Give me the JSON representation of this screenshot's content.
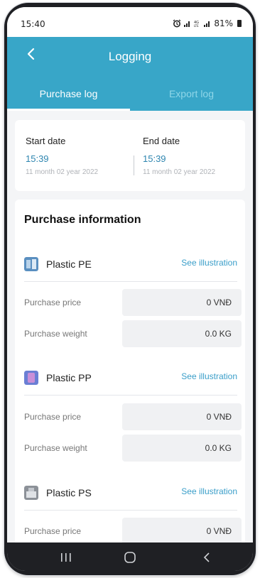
{
  "status": {
    "time": "15:40",
    "battery": "81%"
  },
  "header": {
    "title": "Logging"
  },
  "tabs": [
    {
      "label": "Purchase log",
      "active": true
    },
    {
      "label": "Export log",
      "active": false
    }
  ],
  "dates": {
    "start": {
      "label": "Start date",
      "time": "15:39",
      "date": "11 month 02 year 2022"
    },
    "end": {
      "label": "End date",
      "time": "15:39",
      "date": "11 month 02 year 2022"
    }
  },
  "purchase": {
    "title": "Purchase information",
    "see_label": "See illustration",
    "items": [
      {
        "name": "Plastic PE",
        "icon": "plastic-pe-icon",
        "price_label": "Purchase price",
        "price": "0  VNĐ",
        "weight_label": "Purchase weight",
        "weight": "0.0  KG"
      },
      {
        "name": "Plastic PP",
        "icon": "plastic-pp-icon",
        "price_label": "Purchase price",
        "price": "0  VNĐ",
        "weight_label": "Purchase weight",
        "weight": "0.0  KG"
      },
      {
        "name": "Plastic PS",
        "icon": "plastic-ps-icon",
        "price_label": "Purchase price",
        "price": "0  VNĐ"
      }
    ]
  },
  "colors": {
    "primary": "#38a6c8",
    "link": "#3a9ec9",
    "date_value": "#2f86b0"
  }
}
